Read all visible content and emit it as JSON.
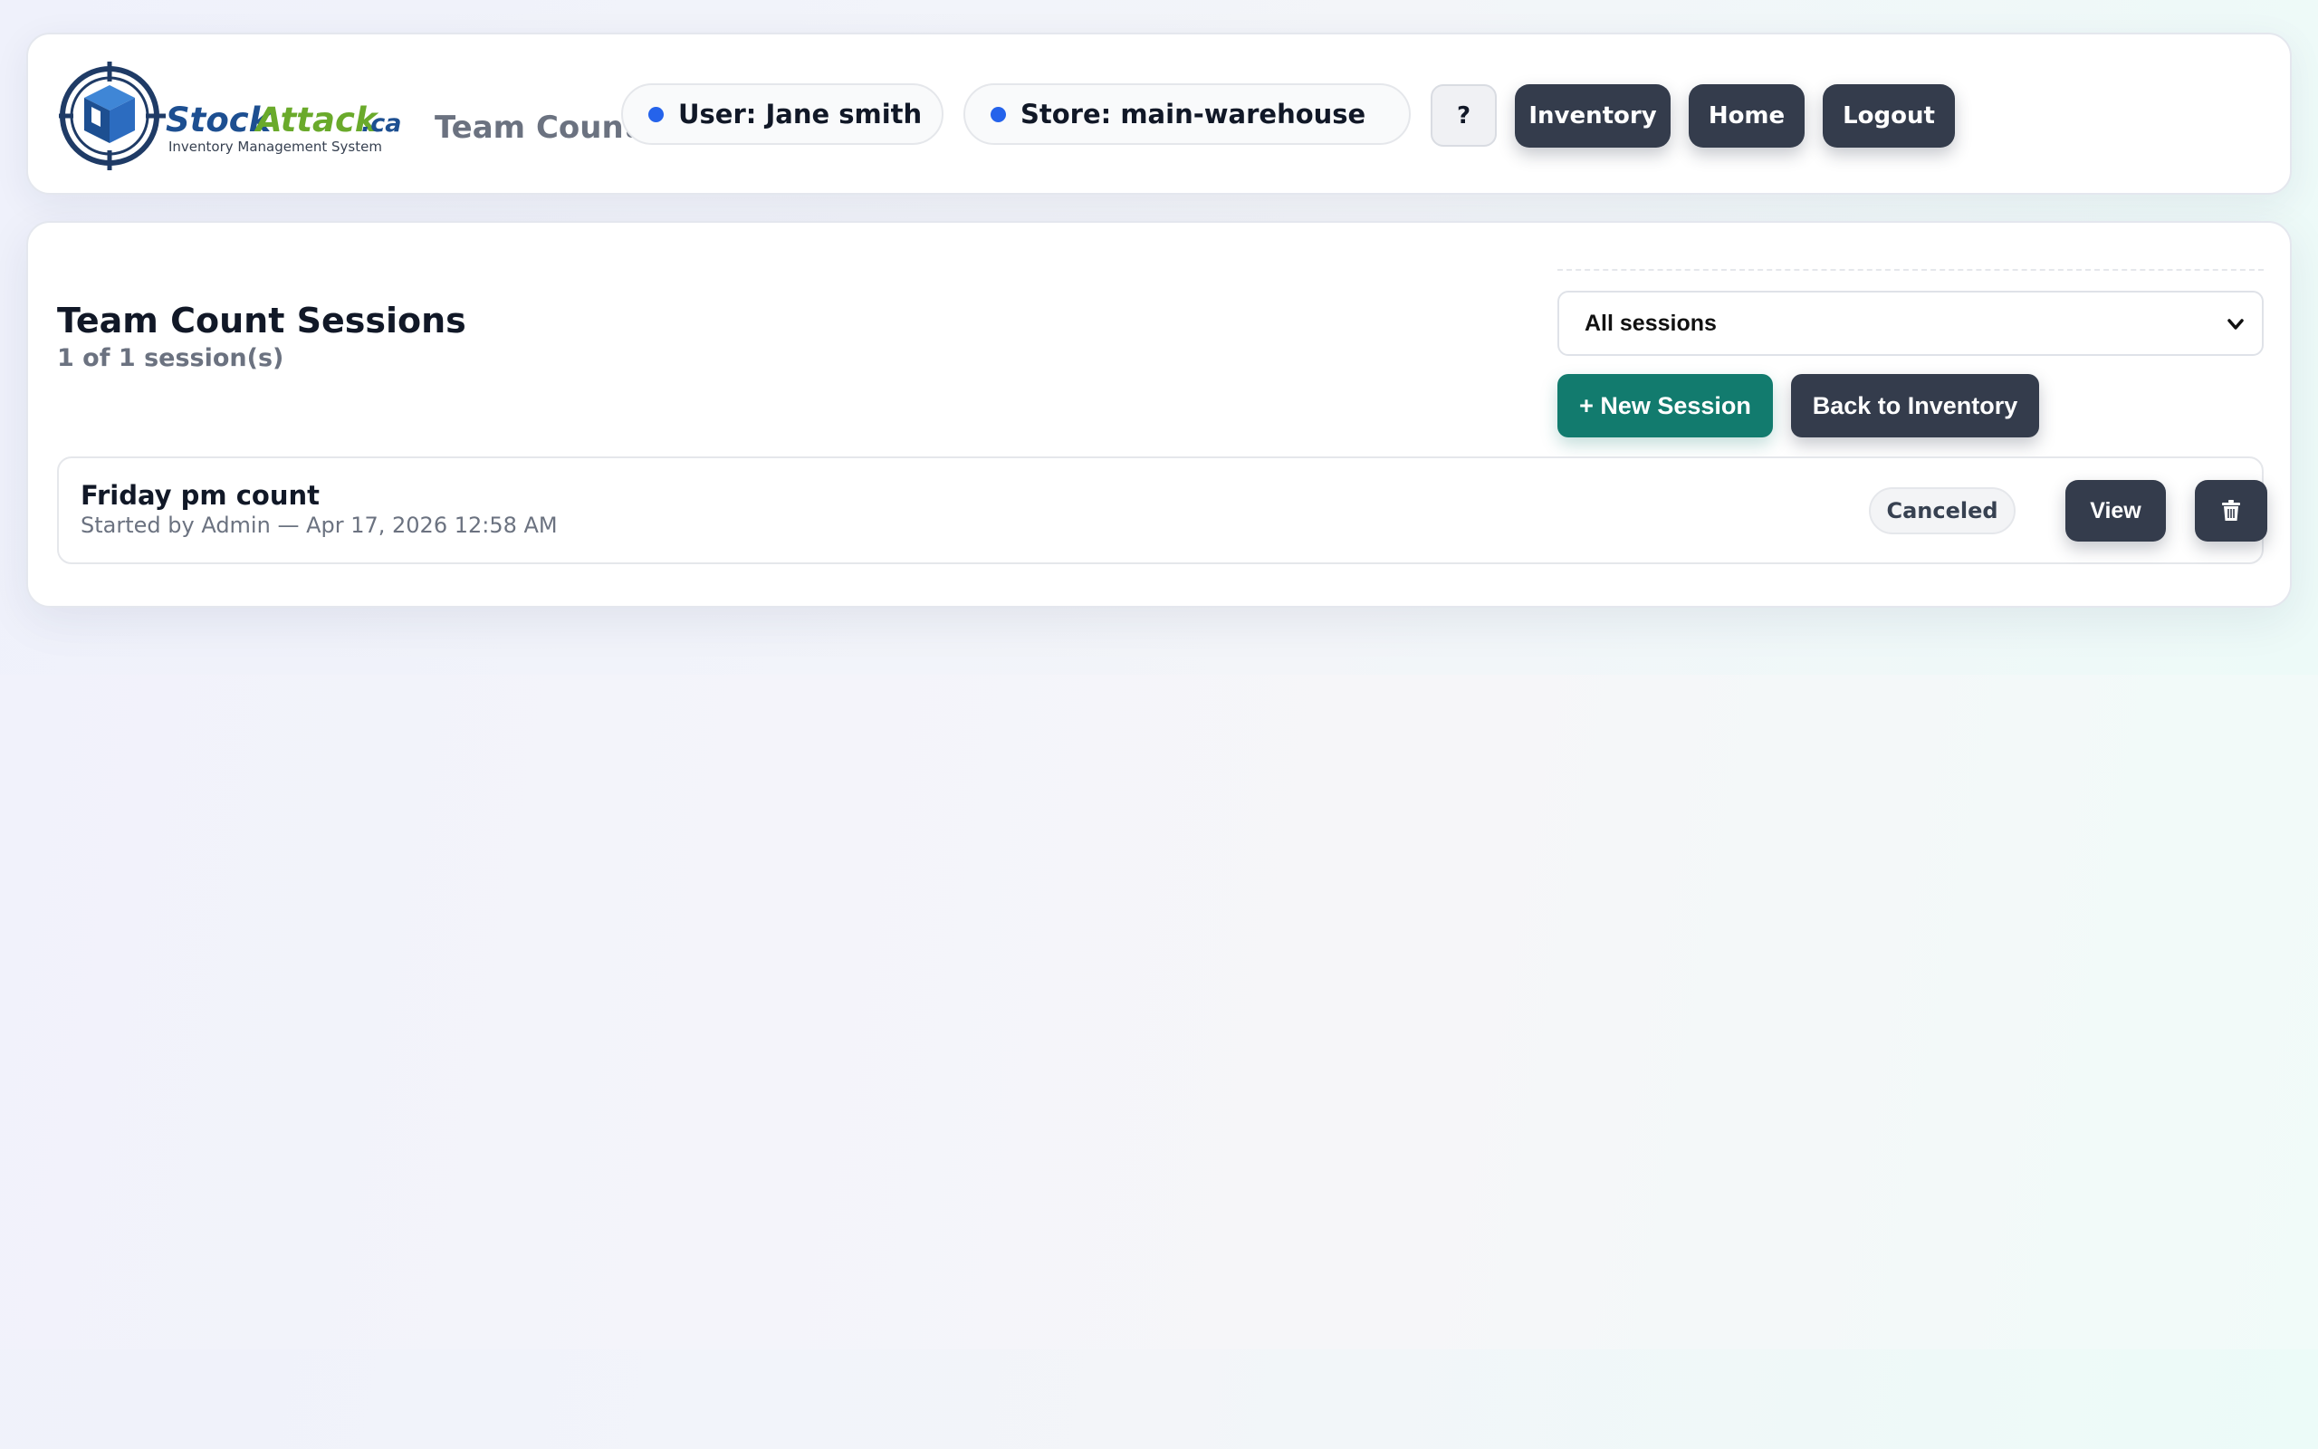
{
  "header": {
    "logo": {
      "brand_part1": "Stock",
      "brand_part2": "Attack",
      "brand_tld": ".ca",
      "tagline": "Inventory Management System"
    },
    "page_label": "Team Count",
    "user_pill": "User: Jane smith",
    "store_pill": "Store: main-warehouse",
    "help_label": "?",
    "nav": {
      "inventory": "Inventory",
      "home": "Home",
      "logout": "Logout"
    }
  },
  "main": {
    "title": "Team Count Sessions",
    "count": "1 of 1 session(s)",
    "filter": {
      "selected": "All sessions"
    },
    "buttons": {
      "new_session": "+ New Session",
      "back_to_inventory": "Back to Inventory"
    },
    "sessions": [
      {
        "name": "Friday pm count",
        "meta": "Started by Admin — Apr 17, 2026 12:58 AM",
        "status": "Canceled",
        "view_label": "View",
        "delete_icon": "trash-icon"
      }
    ]
  },
  "colors": {
    "accent_teal": "#127b6e",
    "dark_button": "#343c4c",
    "status_dot": "#2563eb",
    "brand_blue": "#1d4f91",
    "brand_green": "#6aaa2b"
  }
}
